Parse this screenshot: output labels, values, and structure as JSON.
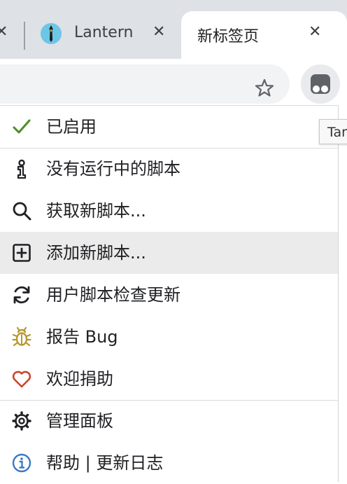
{
  "tabs": [
    {
      "title": "",
      "close": "✕"
    },
    {
      "title": "Lantern",
      "close": "✕"
    },
    {
      "title": "新标签页",
      "close": "✕",
      "active": true
    }
  ],
  "tooltip": "Tampermonkey",
  "menu": {
    "items": [
      {
        "label": "已启用",
        "icon": "check-icon",
        "color": "#4c8c2a"
      },
      {
        "label": "没有运行中的脚本",
        "icon": "script-info-icon",
        "color": "#202124"
      },
      {
        "label": "获取新脚本...",
        "icon": "search-icon",
        "color": "#202124"
      },
      {
        "label": "添加新脚本...",
        "icon": "plus-box-icon",
        "color": "#202124",
        "highlighted": true
      },
      {
        "label": "用户脚本检查更新",
        "icon": "refresh-icon",
        "color": "#202124"
      },
      {
        "label": "报告 Bug",
        "icon": "bug-icon",
        "color": "#b8962e"
      },
      {
        "label": "欢迎捐助",
        "icon": "heart-icon",
        "color": "#c9462c"
      },
      {
        "label": "管理面板",
        "icon": "gear-icon",
        "color": "#202124"
      },
      {
        "label": "帮助 | 更新日志",
        "icon": "info-icon",
        "color": "#3a7bbf"
      }
    ]
  },
  "colors": {
    "tabstrip": "#dee1e6",
    "omnibox": "#f1f3f4",
    "menu_highlight": "#ebebeb"
  }
}
